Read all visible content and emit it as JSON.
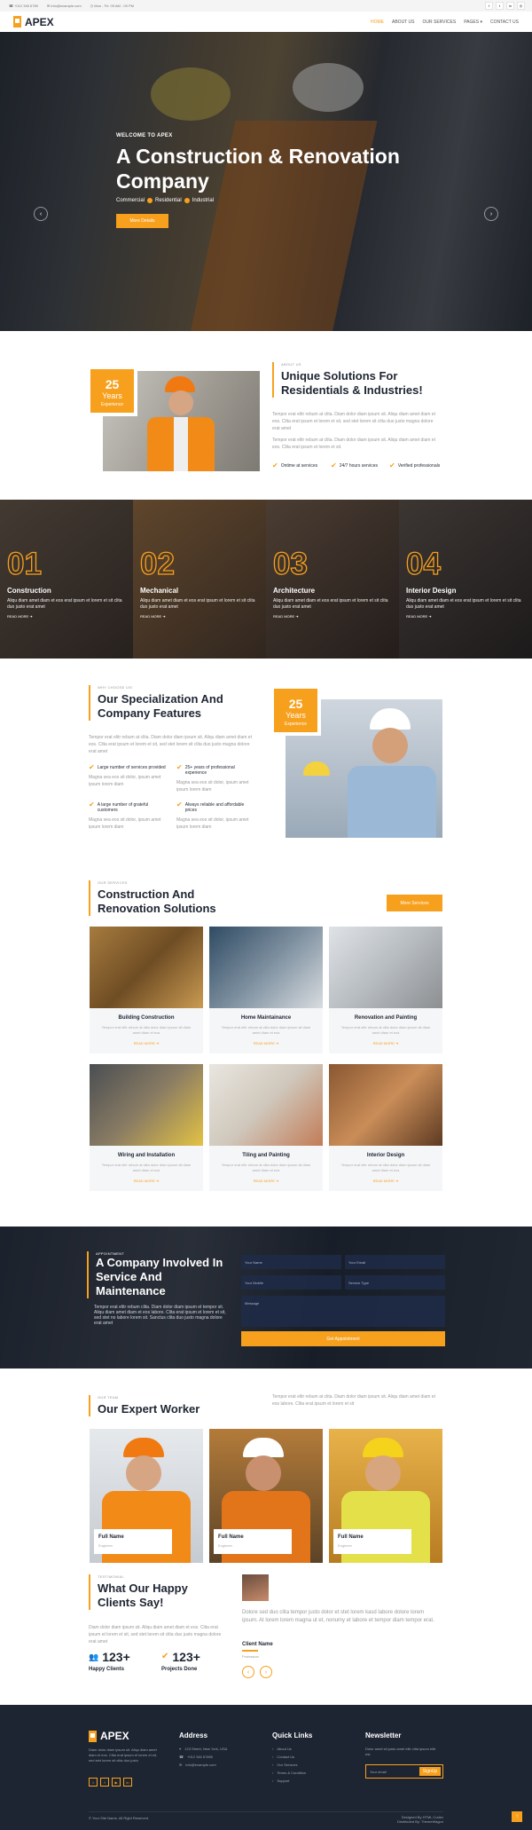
{
  "topbar": {
    "phone": "+012 345 6789",
    "email": "info@example.com",
    "hours": "Mon - Fri: 09 AM - 09 PM"
  },
  "nav": {
    "brand": "APEX",
    "items": [
      "HOME",
      "ABOUT US",
      "OUR SERVICES",
      "PAGES",
      "CONTACT US"
    ]
  },
  "hero": {
    "kicker": "WELCOME TO APEX",
    "title": "A Construction & Renovation Company",
    "tags": [
      "Commercial",
      "Residential",
      "Industrial"
    ],
    "button": "More Details"
  },
  "about": {
    "years": "25",
    "years_word": "Years",
    "experience": "Experience",
    "kicker": "ABOUT US",
    "title": "Unique Solutions For Residentials & Industries!",
    "p1": "Tempor erat elitr rebum at clita. Diam dolor diam ipsum sit. Aliqu diam amet diam et eos. Clita erat ipsum et lorem et sit, sed stet lorem sit clita duo justo magna dolore erat amet",
    "p2": "Tempor erat elitr rebum at clita. Diam dolor diam ipsum sit. Aliqu diam amet diam et eos. Clita erat ipsum et lorem et sit.",
    "features": [
      "Ontime at services",
      "24/7 hours services",
      "Verified professionals"
    ]
  },
  "categories": [
    {
      "num": "01",
      "title": "Construction",
      "text": "Aliqu diam amet diam et eos erat ipsum et lorem et sit clita duo justo erat amet",
      "link": "READ MORE"
    },
    {
      "num": "02",
      "title": "Mechanical",
      "text": "Aliqu diam amet diam et eos erat ipsum et lorem et sit clita duo justo erat amet",
      "link": "READ MORE"
    },
    {
      "num": "03",
      "title": "Architecture",
      "text": "Aliqu diam amet diam et eos erat ipsum et lorem et sit clita duo justo erat amet",
      "link": "READ MORE"
    },
    {
      "num": "04",
      "title": "Interior Design",
      "text": "Aliqu diam amet diam et eos erat ipsum et lorem et sit clita duo justo erat amet",
      "link": "READ MORE"
    }
  ],
  "why": {
    "kicker": "WHY CHOOSE US!",
    "title": "Our Specialization And Company Features",
    "p": "Tempor erat elitr rebum at clita. Diam dolor diam ipsum sit. Aliqu diam amet diam et eos. Clita erat ipsum et lorem et sit, sed stet lorem sit clita duo justo magna dolore erat amet",
    "years": "25",
    "years_word": "Years",
    "experience": "Experience",
    "features": [
      {
        "t": "Large number of services provided",
        "d": "Magna sea eos sit dolor, ipsum amet ipsum lorem diam"
      },
      {
        "t": "25+ years of professional experience",
        "d": "Magna sea eos sit dolor, ipsum amet ipsum lorem diam"
      },
      {
        "t": "A large number of grateful customers",
        "d": "Magna sea eos sit dolor, ipsum amet ipsum lorem diam"
      },
      {
        "t": "Always reliable and affordable prices",
        "d": "Magna sea eos sit dolor, ipsum amet ipsum lorem diam"
      }
    ]
  },
  "services": {
    "kicker": "OUR SERVICES",
    "title": "Construction And Renovation Solutions",
    "button": "More Services",
    "items": [
      {
        "t": "Building Construction"
      },
      {
        "t": "Home Maintainance"
      },
      {
        "t": "Renovation and Painting"
      },
      {
        "t": "Wiring and Installation"
      },
      {
        "t": "Tiling and Painting"
      },
      {
        "t": "Interior Design"
      }
    ],
    "text": "Tempor erat elitr rebum at clita dolor diam ipsum sit diam amet diam et eos",
    "link": "READ MORE"
  },
  "appointment": {
    "kicker": "APPOINTMENT",
    "title": "A Company Involved In Service And Maintenance",
    "p": "Tempor erat elitr rebum clita. Diam dolor diam ipsum et tempor sit. Aliqu diam amet diam et eos labore. Clita erat ipsum et lorem et sit, sed stet no labore lorem sit. Sanctus clita duo justo magna dolore erat amet",
    "ph": {
      "name": "Your Name",
      "email": "Your Email",
      "mobile": "Your Mobile",
      "service": "Service Type",
      "message": "Message"
    },
    "button": "Get Appointment"
  },
  "team": {
    "kicker": "OUR TEAM",
    "title": "Our Expert Worker",
    "p": "Tempor erat elitr rebum at clita. Diam dolor diam ipsum sit. Aliqu diam amet diam et eos labore. Clita erat ipsum et lorem et sit",
    "members": [
      {
        "n": "Full Name",
        "r": "Engineer"
      },
      {
        "n": "Full Name",
        "r": "Engineer"
      },
      {
        "n": "Full Name",
        "r": "Engineer"
      }
    ]
  },
  "testimonial": {
    "kicker": "TESTIMONIAL",
    "title": "What Our Happy Clients Say!",
    "p": "Diam dolor diam ipsum sit. Aliqu diam amet diam et eos. Clita erat ipsum et lorem et sit, sed stet lorem sit clita duo justo magna dolore erat amet",
    "s1": {
      "v": "123+",
      "l": "Happy Clients"
    },
    "s2": {
      "v": "123+",
      "l": "Projects Done"
    },
    "quote": "Dolore sed duo clita tempor justo dolor et stet lorem kasd labore dolore lorem ipsum. At lorem lorem magna ut et, nonumy et labore et tempor diam tempor erat.",
    "name": "Client Name",
    "role": "Profession"
  },
  "footer": {
    "brand": "APEX",
    "about": "Diam dolor diam ipsum sit. Aliqu diam amet diam et eos. Clita erat ipsum et lorem et sit, sed stet lorem sit clita duo justo",
    "address_h": "Address",
    "address": "123 Street, New York, USA",
    "phone": "+012 345 67890",
    "email": "info@example.com",
    "links_h": "Quick Links",
    "links": [
      "About Us",
      "Contact Us",
      "Our Services",
      "Terms & Condition",
      "Support"
    ],
    "news_h": "Newsletter",
    "news_p": "Dolor amet sit justo amet elitr clita ipsum elitr est.",
    "news_ph": "Your email",
    "news_btn": "SignUp",
    "copy": "© Your Site Name, All Right Reserved.",
    "designed": "Designed By HTML Codex",
    "dist": "Distributed By: ThemeWagon"
  },
  "colors": {
    "accent": "#f7a01d",
    "dark": "#1e2532"
  }
}
